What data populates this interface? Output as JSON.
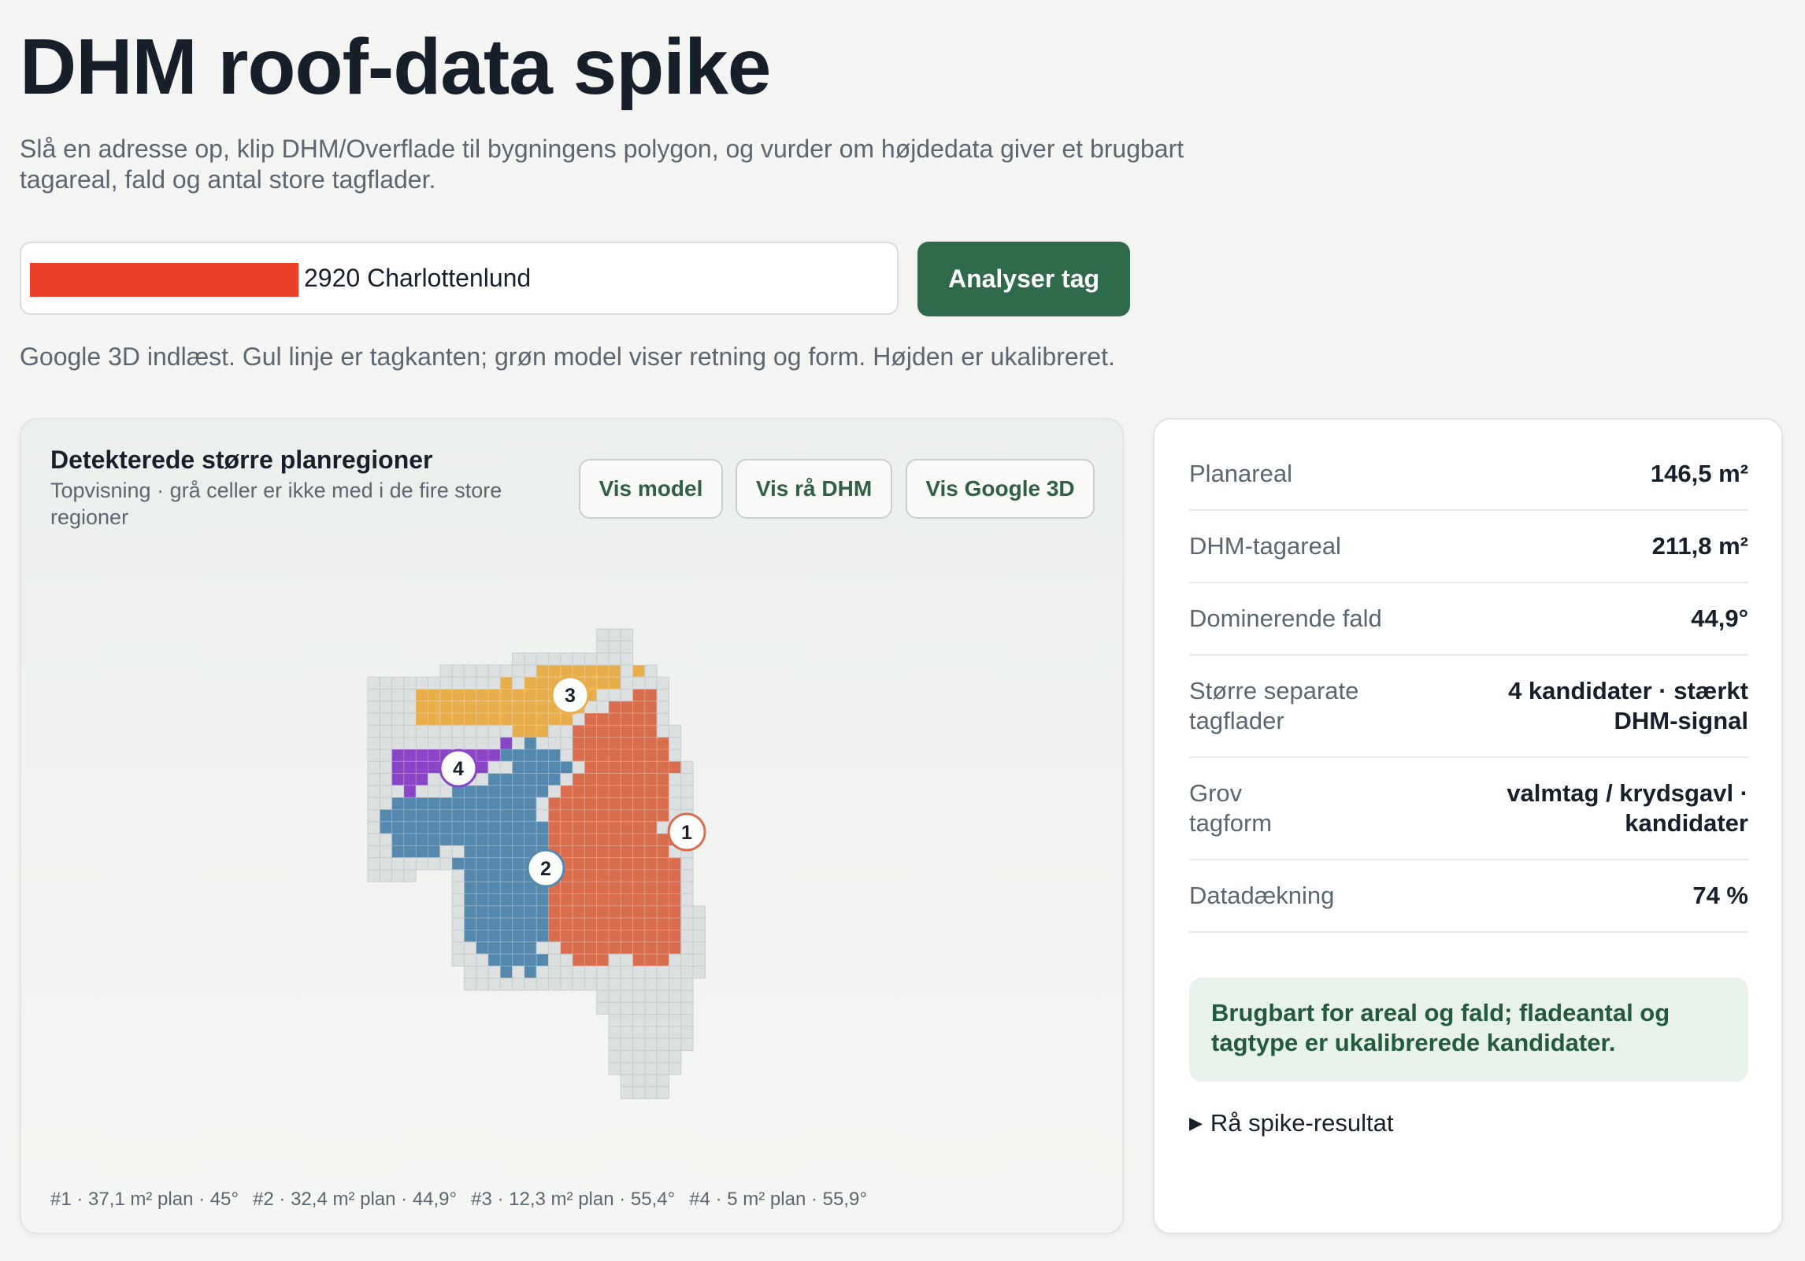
{
  "header": {
    "title": "DHM roof-data spike",
    "intro": "Slå en adresse op, klip DHM/Overflade til bygningens polygon, og vurder om højdedata giver et brugbart tagareal, fald og antal store tagflader."
  },
  "search": {
    "address_value": "2920 Charlottenlund",
    "button_label": "Analyser tag"
  },
  "status": "Google 3D indlæst. Gul linje er tagkanten; grøn model viser retning og form. Højden er ukalibreret.",
  "map_card": {
    "title": "Detekterede større planregioner",
    "subtitle": "Topvisning · grå celler er ikke med i de fire store regioner",
    "buttons": [
      "Vis model",
      "Vis rå DHM",
      "Vis Google 3D"
    ],
    "region_colors": {
      "1": "#d96d4d",
      "2": "#5588ad",
      "3": "#e8ae4a",
      "4": "#8a44c6",
      "grey": "#dde0e0"
    },
    "regions": [
      {
        "id": "1",
        "label": "#1 · 37,1 m² plan · 45°"
      },
      {
        "id": "2",
        "label": "#2 · 32,4 m² plan · 44,9°"
      },
      {
        "id": "3",
        "label": "#3 · 12,3 m² plan · 55,4°"
      },
      {
        "id": "4",
        "label": "#4 · 5 m² plan · 55,9°"
      }
    ]
  },
  "stats": {
    "rows": [
      {
        "label": "Planareal",
        "value": "146,5 m²"
      },
      {
        "label": "DHM-tagareal",
        "value": "211,8 m²"
      },
      {
        "label": "Dominerende fald",
        "value": "44,9°"
      },
      {
        "label": "Større separate tagflader",
        "value": "4 kandidater · stærkt DHM-signal"
      },
      {
        "label": "Grov tagform",
        "value": "valmtag / krydsgavl · kandidater"
      },
      {
        "label": "Datadækning",
        "value": "74 %"
      }
    ],
    "verdict": "Brugbart for areal og fald; fladeantal og tagtype er ukalibrerede kandidater.",
    "raw_toggle": "Rå spike-resultat"
  }
}
